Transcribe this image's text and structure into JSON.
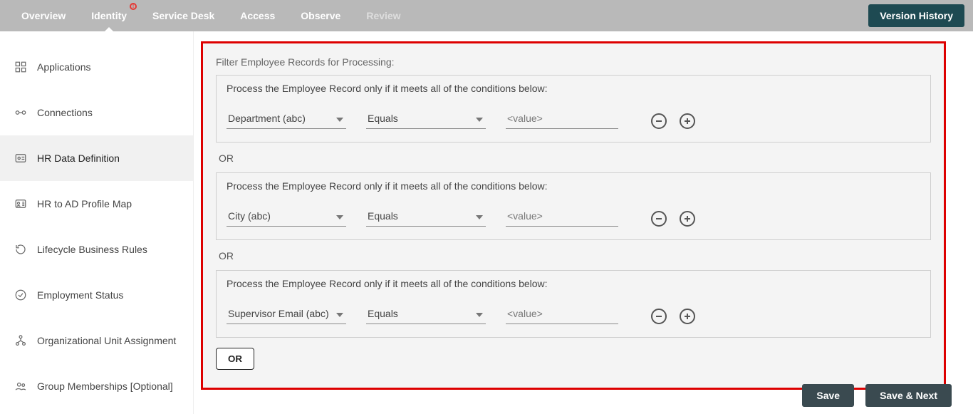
{
  "topnav": {
    "tabs": [
      {
        "label": "Overview"
      },
      {
        "label": "Identity",
        "active": true,
        "alert": true
      },
      {
        "label": "Service Desk"
      },
      {
        "label": "Access"
      },
      {
        "label": "Observe"
      },
      {
        "label": "Review",
        "muted": true
      }
    ],
    "version_btn": "Version History"
  },
  "sidebar": {
    "items": [
      {
        "label": "Applications"
      },
      {
        "label": "Connections"
      },
      {
        "label": "HR Data Definition",
        "active": true
      },
      {
        "label": "HR to AD Profile Map"
      },
      {
        "label": "Lifecycle Business Rules"
      },
      {
        "label": "Employment Status"
      },
      {
        "label": "Organizational Unit Assignment"
      },
      {
        "label": "Group Memberships [Optional]"
      }
    ]
  },
  "filter": {
    "title": "Filter Employee Records for Processing:",
    "group_label": "Process the Employee Record only if it meets all of the conditions below:",
    "or_label": "OR",
    "value_placeholder": "<value>",
    "groups": [
      {
        "attr": "Department (abc)",
        "op": "Equals"
      },
      {
        "attr": "City (abc)",
        "op": "Equals"
      },
      {
        "attr": "Supervisor Email (abc)",
        "op": "Equals"
      }
    ],
    "add_or_btn": "OR"
  },
  "footer": {
    "save": "Save",
    "save_next": "Save & Next"
  }
}
